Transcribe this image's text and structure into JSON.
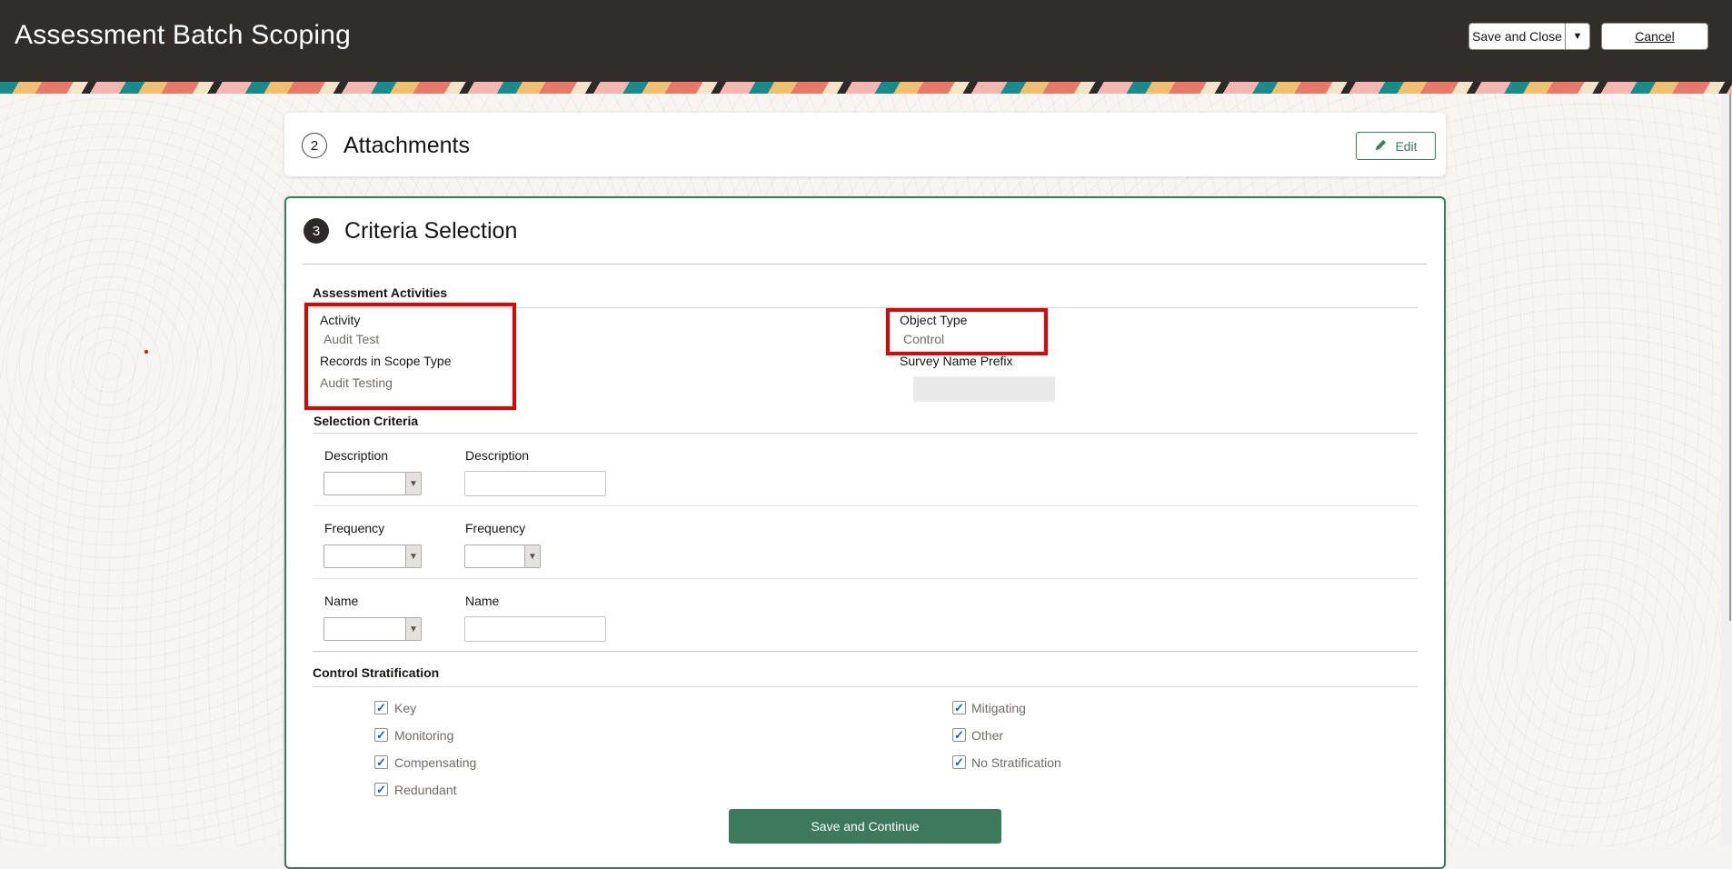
{
  "header": {
    "title": "Assessment Batch Scoping",
    "save_close_label": "Save and Close",
    "cancel_label": "Cancel"
  },
  "attachments": {
    "step": "2",
    "title": "Attachments",
    "edit_label": "Edit"
  },
  "criteria": {
    "step": "3",
    "title": "Criteria Selection",
    "assessment_activities": {
      "header": "Assessment Activities",
      "activity_label": "Activity",
      "activity_value": "Audit Test",
      "records_scope_label": "Records in Scope Type",
      "records_scope_value": "Audit Testing",
      "object_type_label": "Object Type",
      "object_type_value": "Control",
      "survey_prefix_label": "Survey Name Prefix"
    },
    "selection_criteria": {
      "header": "Selection Criteria",
      "rows": [
        {
          "operator_label": "Description",
          "value_label": "Description"
        },
        {
          "operator_label": "Frequency",
          "value_label": "Frequency"
        },
        {
          "operator_label": "Name",
          "value_label": "Name"
        }
      ]
    },
    "control_stratification": {
      "header": "Control Stratification",
      "left": [
        {
          "label": "Key",
          "checked": true
        },
        {
          "label": "Monitoring",
          "checked": true
        },
        {
          "label": "Compensating",
          "checked": true
        },
        {
          "label": "Redundant",
          "checked": true
        }
      ],
      "right": [
        {
          "label": "Mitigating",
          "checked": true
        },
        {
          "label": "Other",
          "checked": true
        },
        {
          "label": "No Stratification",
          "checked": true
        }
      ]
    },
    "save_continue_label": "Save and Continue"
  },
  "colors": {
    "header_bg": "#312d2a",
    "accent_green": "#3d7a5c",
    "highlight_red": "#e50000",
    "checkbox_blue": "#1e5fa8"
  }
}
